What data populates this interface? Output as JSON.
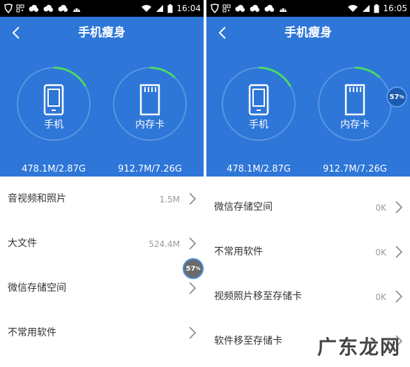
{
  "statusbar": {
    "left_time": "16:04",
    "right_time": "16:05",
    "icons": [
      "shield-icon",
      "qr-icon",
      "weather-icon",
      "weather-icon",
      "android-icon",
      "wifi-icon",
      "signal-icon",
      "battery-icon"
    ]
  },
  "left": {
    "title": "手机瘦身",
    "phone": {
      "label": "手机",
      "value": "478.1M/2.87G",
      "usage_fraction": 0.17
    },
    "sd": {
      "label": "内存卡",
      "value": "912.7M/7.26G",
      "usage_fraction": 0.12
    },
    "items": [
      {
        "label": "音视频和照片",
        "size": "1.5M"
      },
      {
        "label": "大文件",
        "size": "524.4M"
      },
      {
        "label": "微信存储空间",
        "size": ""
      },
      {
        "label": "不常用软件",
        "size": ""
      }
    ],
    "bubble": {
      "value": "57",
      "unit": "%"
    }
  },
  "right": {
    "title": "手机瘦身",
    "phone": {
      "label": "手机",
      "value": "478.1M/2.87G",
      "usage_fraction": 0.17
    },
    "sd": {
      "label": "内存卡",
      "value": "912.7M/7.26G",
      "usage_fraction": 0.12
    },
    "items": [
      {
        "label": "微信存储空间",
        "size": "0K"
      },
      {
        "label": "不常用软件",
        "size": "0K"
      },
      {
        "label": "视频照片移至存储卡",
        "size": "0K"
      },
      {
        "label": "软件移至存储卡",
        "size": ""
      }
    ],
    "bubble": {
      "value": "57",
      "unit": "%"
    }
  },
  "watermark": "广东龙网",
  "colors": {
    "header_blue": "#2e76d8",
    "ring_track": "#5b95e2",
    "ring_progress": "#4cd964",
    "row_label": "#333333",
    "row_size": "#999999"
  }
}
